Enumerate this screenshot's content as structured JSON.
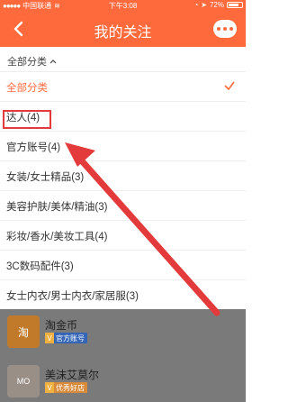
{
  "status": {
    "carrier": "中国联通",
    "time": "下午3:08",
    "battery": "72%"
  },
  "nav": {
    "title": "我的关注"
  },
  "filter": {
    "label": "全部分类"
  },
  "menu": {
    "items": [
      {
        "label": "全部分类"
      },
      {
        "label": "达人(4)"
      },
      {
        "label": "官方账号(4)"
      },
      {
        "label": "女装/女士精品(3)"
      },
      {
        "label": "美容护肤/美体/精油(3)"
      },
      {
        "label": "彩妆/香水/美妆工具(4)"
      },
      {
        "label": "3C数码配件(3)"
      },
      {
        "label": "女士内衣/男士内衣/家居服(3)"
      }
    ]
  },
  "list": [
    {
      "name": "淘金币",
      "badge": "官方账号",
      "logo_text": "淘"
    },
    {
      "name": "美沫艾莫尔",
      "badge": "优秀好店",
      "logo_text": "MO"
    }
  ],
  "colors": {
    "accent": "#ff6a3d",
    "annotation": "#e33b3b"
  },
  "icons": {
    "back": "chevron-left-icon",
    "more": "more-dots-icon",
    "check": "checkmark-icon",
    "caret": "chevron-up-icon"
  }
}
